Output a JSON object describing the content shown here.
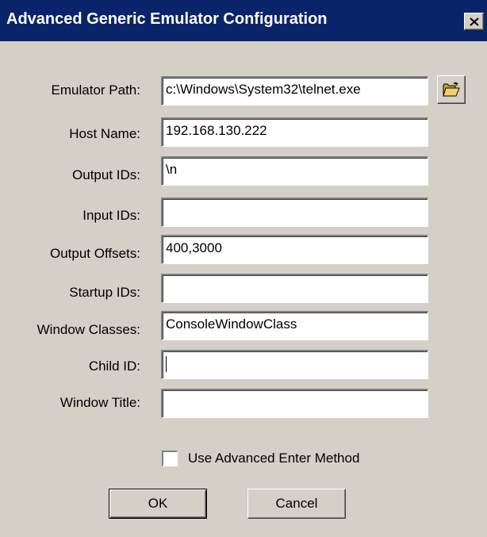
{
  "window": {
    "title": "Advanced Generic Emulator Configuration",
    "close_icon": "close-icon"
  },
  "fields": [
    {
      "label": "Emulator Path:",
      "value": "c:\\Windows\\System32\\telnet.exe"
    },
    {
      "label": "Host Name:",
      "value": "192.168.130.222"
    },
    {
      "label": "Output IDs:",
      "value": "\\n"
    },
    {
      "label": "Input IDs:",
      "value": ""
    },
    {
      "label": "Output Offsets:",
      "value": "400,3000"
    },
    {
      "label": "Startup IDs:",
      "value": ""
    },
    {
      "label": "Window Classes:",
      "value": "ConsoleWindowClass"
    },
    {
      "label": "Child ID:",
      "value": ""
    },
    {
      "label": "Window Title:",
      "value": ""
    }
  ],
  "browse": {
    "icon": "open-folder-icon"
  },
  "options": {
    "use_advanced_enter_label": "Use Advanced Enter Method",
    "use_advanced_enter_checked": false
  },
  "buttons": {
    "ok_label": "OK",
    "cancel_label": "Cancel"
  },
  "colors": {
    "titlebar": "#0a246a",
    "dialog_face": "#d4d0c8",
    "folder_yellow": "#f2d36b"
  }
}
